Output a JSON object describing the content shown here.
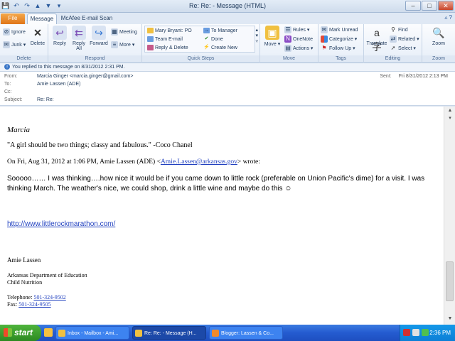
{
  "window": {
    "title": "Re: Re: - Message (HTML)"
  },
  "tabs": [
    {
      "label": "File"
    },
    {
      "label": "Message"
    },
    {
      "label": "McAfee E-mail Scan"
    }
  ],
  "ribbon": {
    "delete_group": {
      "ignore": "Ignore",
      "junk": "Junk",
      "delete": "Delete",
      "label": "Delete"
    },
    "respond_group": {
      "reply": "Reply",
      "reply_all_1": "Reply",
      "reply_all_2": "All",
      "forward": "Forward",
      "meeting": "Meeting",
      "more": "More",
      "label": "Respond"
    },
    "quick_steps": {
      "mary": "Mary Bryant: PO",
      "team": "Team E-mail",
      "reply_delete": "Reply & Delete",
      "manager": "To Manager",
      "done": "Done",
      "create": "Create New",
      "label": "Quick Steps"
    },
    "move_group": {
      "move": "Move",
      "rules": "Rules",
      "onenote": "OneNote",
      "actions": "Actions",
      "label": "Move"
    },
    "tags_group": {
      "unread": "Mark Unread",
      "categorize": "Categorize",
      "follow": "Follow Up",
      "label": "Tags"
    },
    "editing_group": {
      "translate": "Translate",
      "find": "Find",
      "related": "Related",
      "select": "Select",
      "label": "Editing"
    },
    "zoom_group": {
      "zoom": "Zoom",
      "label": "Zoom"
    }
  },
  "infobar": {
    "text": "You replied to this message on 8/31/2012 2:31 PM."
  },
  "header": {
    "from_label": "From:",
    "from": "Marcia Ginger <marcia.ginger@gmail.com>",
    "to_label": "To:",
    "to": "Amie Lassen (ADE)",
    "cc_label": "Cc:",
    "subject_label": "Subject:",
    "subject": "Re: Re:",
    "sent_label": "Sent:",
    "sent": "Fri 8/31/2012 2:13 PM"
  },
  "body": {
    "signature_name": "Marcia",
    "quote": "\"A girl should be two things; classy and fabulous.\"  -Coco Chanel",
    "on_wrote_prefix": "On Fri, Aug 31, 2012 at 1:06 PM, Amie Lassen (ADE) <",
    "on_wrote_email": "Amie.Lassen@arkansas.gov",
    "on_wrote_suffix": "> wrote:",
    "paragraph": "Sooooo…… I was thinking….how nice it would be if you came down to little rock (preferable on Union Pacific's dime) for a visit. I was thinking March. The weather's nice, we could shop, drink a little wine and maybe do this ☺",
    "url": "http://www.littlerockmarathon.com/",
    "sender_name": "Amie Lassen",
    "org_line1": "Arkansas Department of Education",
    "org_line2": "Child Nutrition",
    "tel_label": "Telephone: ",
    "tel": "501-324-9502",
    "fax_label": "Fax: ",
    "fax": "501-324-9505"
  },
  "taskbar": {
    "start": "start",
    "tasks": [
      {
        "label": "Inbox - Mailbox - Ami..."
      },
      {
        "label": "Re: Re: - Message (H..."
      },
      {
        "label": "Blogger: Lassen & Co..."
      }
    ],
    "clock": "2:36 PM"
  }
}
